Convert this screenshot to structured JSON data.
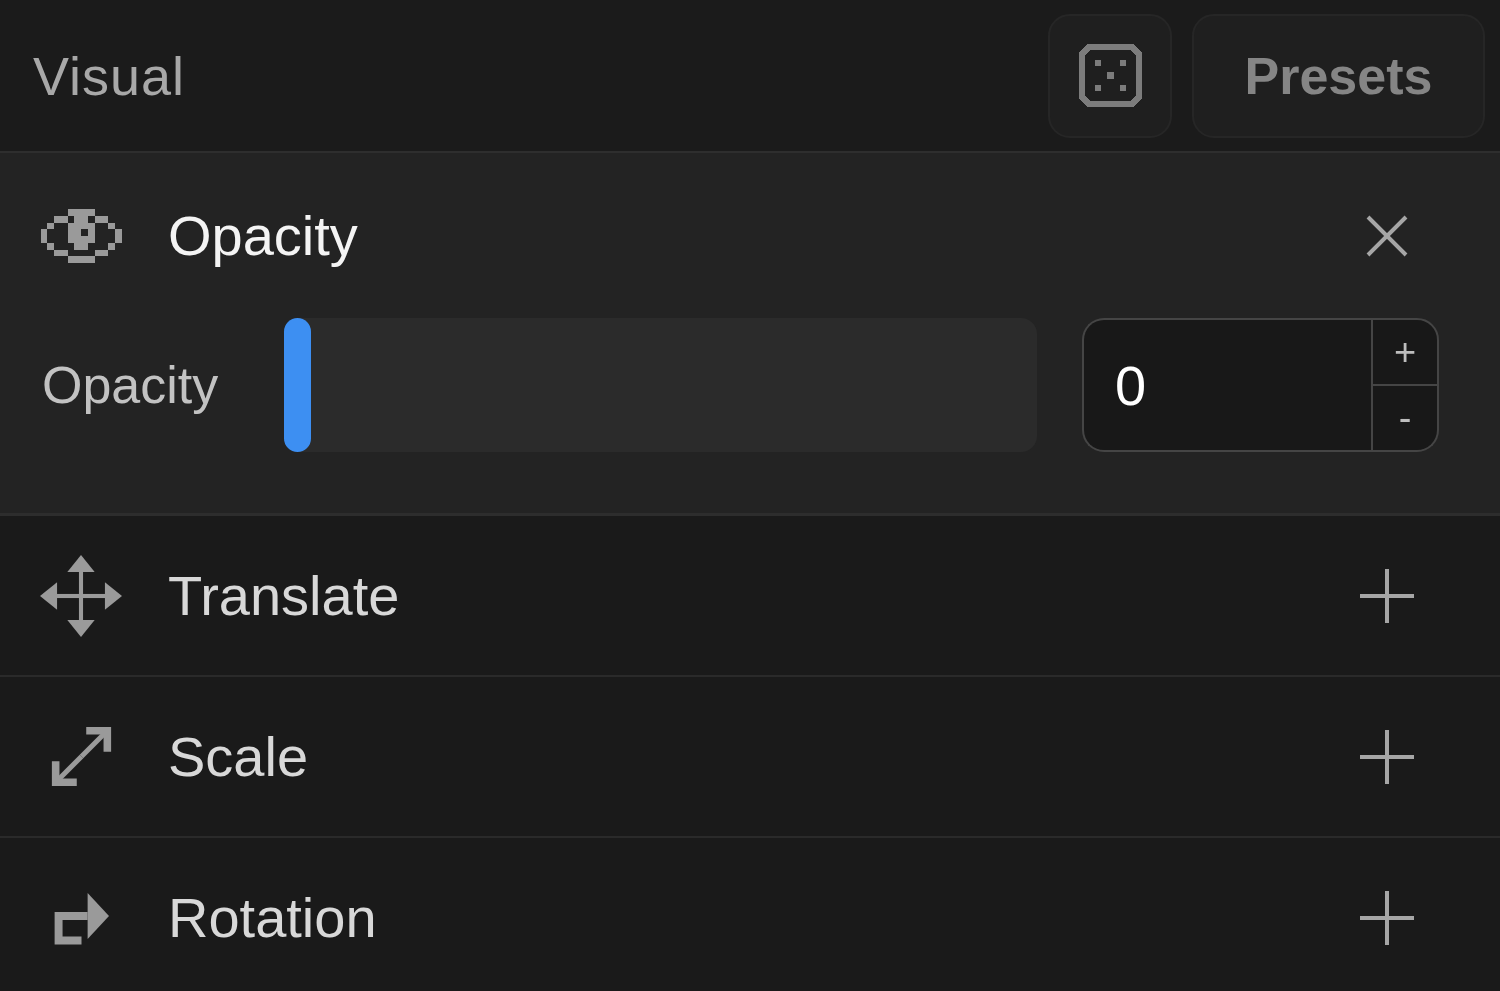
{
  "header": {
    "title": "Visual",
    "presets_button": "Presets"
  },
  "effects": [
    {
      "label": "Opacity",
      "expanded": true,
      "control": {
        "label": "Opacity",
        "level": 0,
        "value": "0",
        "increment": "+",
        "decrement": "-"
      }
    },
    {
      "label": "Translate",
      "expanded": false
    },
    {
      "label": "Scale",
      "expanded": false
    },
    {
      "label": "Rotation",
      "expanded": false
    }
  ]
}
